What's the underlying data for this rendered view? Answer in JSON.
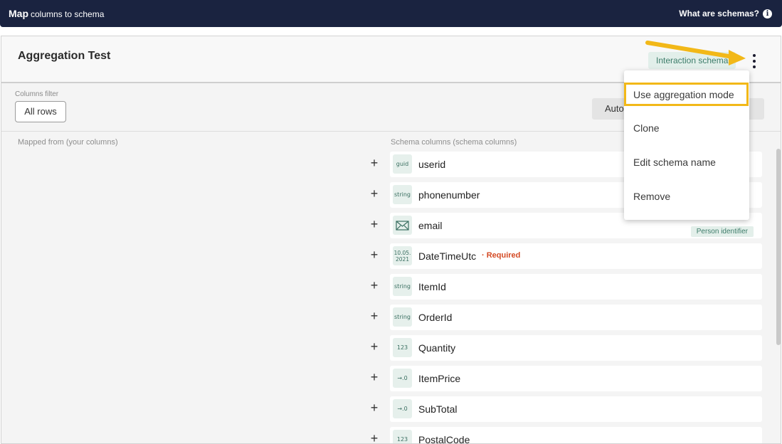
{
  "topbar": {
    "title_bold": "Map",
    "title_rest": "columns to schema",
    "help_label": "What are schemas?",
    "help_icon": "info-icon"
  },
  "panel": {
    "title": "Aggregation Test",
    "schema_badge": "Interaction schema",
    "more_icon": "kebab-vertical-icon"
  },
  "filter": {
    "label": "Columns filter",
    "value": "All rows",
    "auto_button": "Auto"
  },
  "columns": {
    "left_header": "Mapped from (your columns)",
    "right_header": "Schema columns (schema columns)"
  },
  "rows": [
    {
      "type": "guid",
      "name": "userid",
      "required": "",
      "badge": ""
    },
    {
      "type": "string",
      "name": "phonenumber",
      "required": "",
      "badge": ""
    },
    {
      "type": "email-icon",
      "name": "email",
      "required": "",
      "badge": "Person identifier"
    },
    {
      "type": "10.05.\n2021",
      "name": "DateTimeUtc",
      "required": "· Required",
      "badge": ""
    },
    {
      "type": "string",
      "name": "ItemId",
      "required": "",
      "badge": ""
    },
    {
      "type": "string",
      "name": "OrderId",
      "required": "",
      "badge": ""
    },
    {
      "type": "123",
      "name": "Quantity",
      "required": "",
      "badge": ""
    },
    {
      "type": "→.0",
      "name": "ItemPrice",
      "required": "",
      "badge": ""
    },
    {
      "type": "→.0",
      "name": "SubTotal",
      "required": "",
      "badge": ""
    },
    {
      "type": "123",
      "name": "PostalCode",
      "required": "",
      "badge": ""
    }
  ],
  "menu": {
    "items": [
      "Use aggregation mode",
      "Clone",
      "Edit schema name",
      "Remove"
    ],
    "highlight_color": "#f2b818"
  },
  "colors": {
    "navy": "#1a2340",
    "accent_green": "#3d7c6a",
    "required_red": "#d44a24",
    "annotation_yellow": "#f2b818"
  }
}
